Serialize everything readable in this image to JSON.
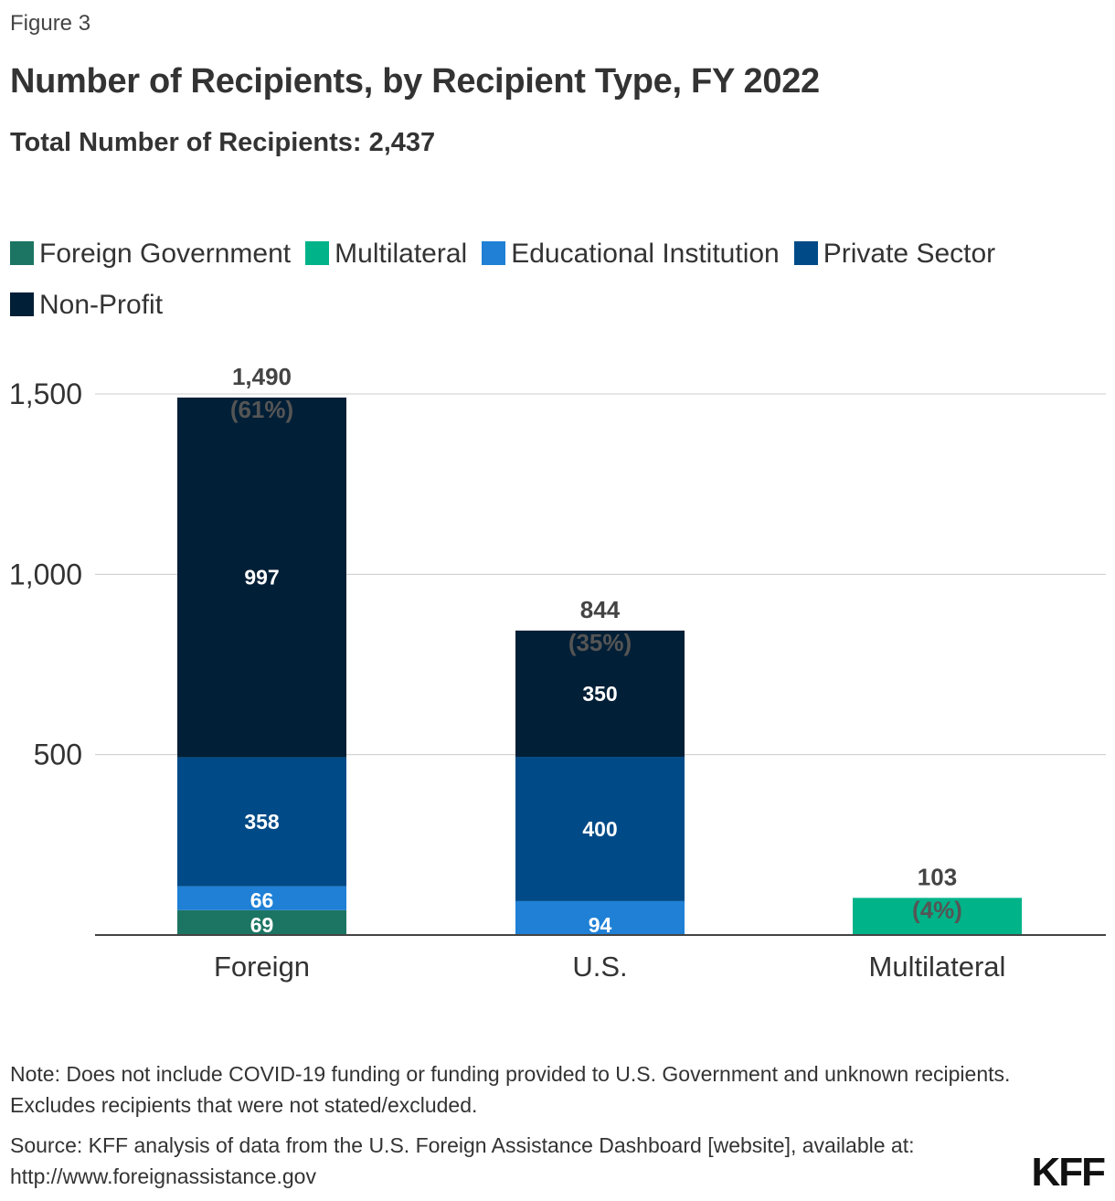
{
  "figure_label": "Figure 3",
  "logo": "KFF",
  "note": "Note: Does not include COVID-19 funding or funding provided to U.S. Government and unknown recipients. Excludes recipients that were not stated/excluded.",
  "source": "Source: KFF analysis of data from the U.S. Foreign Assistance Dashboard [website], available at: http://www.foreignassistance.gov",
  "chart_data": {
    "type": "bar",
    "stacked": true,
    "title": "Number of Recipients, by Recipient Type, FY 2022",
    "subtitle": "Total Number of Recipients: 2,437",
    "xlabel": "",
    "ylabel": "",
    "ylim": [
      0,
      1500
    ],
    "yticks": [
      500,
      1000,
      1500
    ],
    "ytick_labels": [
      "500",
      "1,000",
      "1,500"
    ],
    "grid": true,
    "legend_position": "top-left",
    "categories": [
      "Foreign",
      "U.S.",
      "Multilateral"
    ],
    "series": [
      {
        "name": "Foreign Government",
        "color": "#1c7563",
        "values": [
          69,
          0,
          0
        ]
      },
      {
        "name": "Multilateral",
        "color": "#00b389",
        "values": [
          0,
          0,
          103
        ]
      },
      {
        "name": "Educational Institution",
        "color": "#1f80d6",
        "values": [
          66,
          94,
          0
        ]
      },
      {
        "name": "Private Sector",
        "color": "#004a87",
        "values": [
          358,
          400,
          0
        ]
      },
      {
        "name": "Non-Profit",
        "color": "#011f36",
        "values": [
          997,
          350,
          0
        ]
      }
    ],
    "totals": [
      {
        "value_label": "1,490",
        "pct_label": "(61%)"
      },
      {
        "value_label": "844",
        "pct_label": "(35%)"
      },
      {
        "value_label": "103",
        "pct_label": "(4%)"
      }
    ]
  }
}
